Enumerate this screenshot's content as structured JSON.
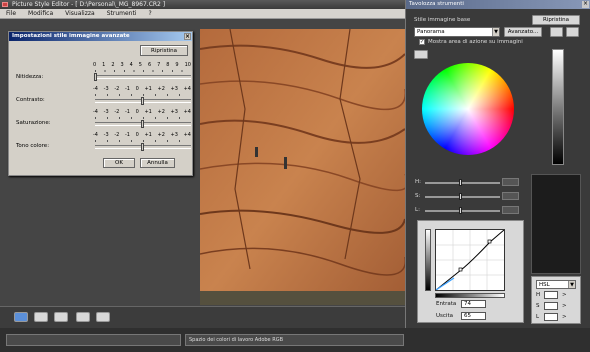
{
  "app": {
    "title": "Picture Style Editor - [ D:\\Personal\\_MG_8967.CR2 ]"
  },
  "menu": [
    "File",
    "Modifica",
    "Visualizza",
    "Strumenti",
    "?"
  ],
  "dialog": {
    "title": "Impostazioni stile immagine avanzate",
    "reset_label": "Ripristina",
    "ok_label": "OK",
    "cancel_label": "Annulla",
    "params": [
      {
        "label": "Nitidezza:",
        "ticks": [
          "0",
          "1",
          "2",
          "3",
          "4",
          "5",
          "6",
          "7",
          "8",
          "9",
          "10"
        ],
        "value": 0
      },
      {
        "label": "Contrasto:",
        "ticks": [
          "-4",
          "-3",
          "-2",
          "-1",
          "0",
          "+1",
          "+2",
          "+3",
          "+4"
        ],
        "value": 0
      },
      {
        "label": "Saturazione:",
        "ticks": [
          "-4",
          "-3",
          "-2",
          "-1",
          "0",
          "+1",
          "+2",
          "+3",
          "+4"
        ],
        "value": 0
      },
      {
        "label": "Tono colore:",
        "ticks": [
          "-4",
          "-3",
          "-2",
          "-1",
          "0",
          "+1",
          "+2",
          "+3",
          "+4"
        ],
        "value": 0
      }
    ]
  },
  "panel": {
    "title": "Tavolozza strumenti",
    "base_style_label": "Stile immagine base",
    "reset_label": "Ripristina",
    "base_style_value": "Panorama",
    "advanced_label": "Avanzato...",
    "show_area_label": "Mostra area di azione su immagini",
    "show_area_checked": true,
    "h_label": "H:",
    "s_label": "S:",
    "l_label": "L:",
    "input_label": "Entrata",
    "input_value": "74",
    "output_label": "Uscita",
    "output_value": "65",
    "mode_value": "HSL",
    "mode_h": "H",
    "mode_s": "S",
    "mode_l": "L",
    "mode_arrow": ">"
  },
  "status": {
    "right": "Spazio dei colori di lavoro Adobe RGB"
  }
}
